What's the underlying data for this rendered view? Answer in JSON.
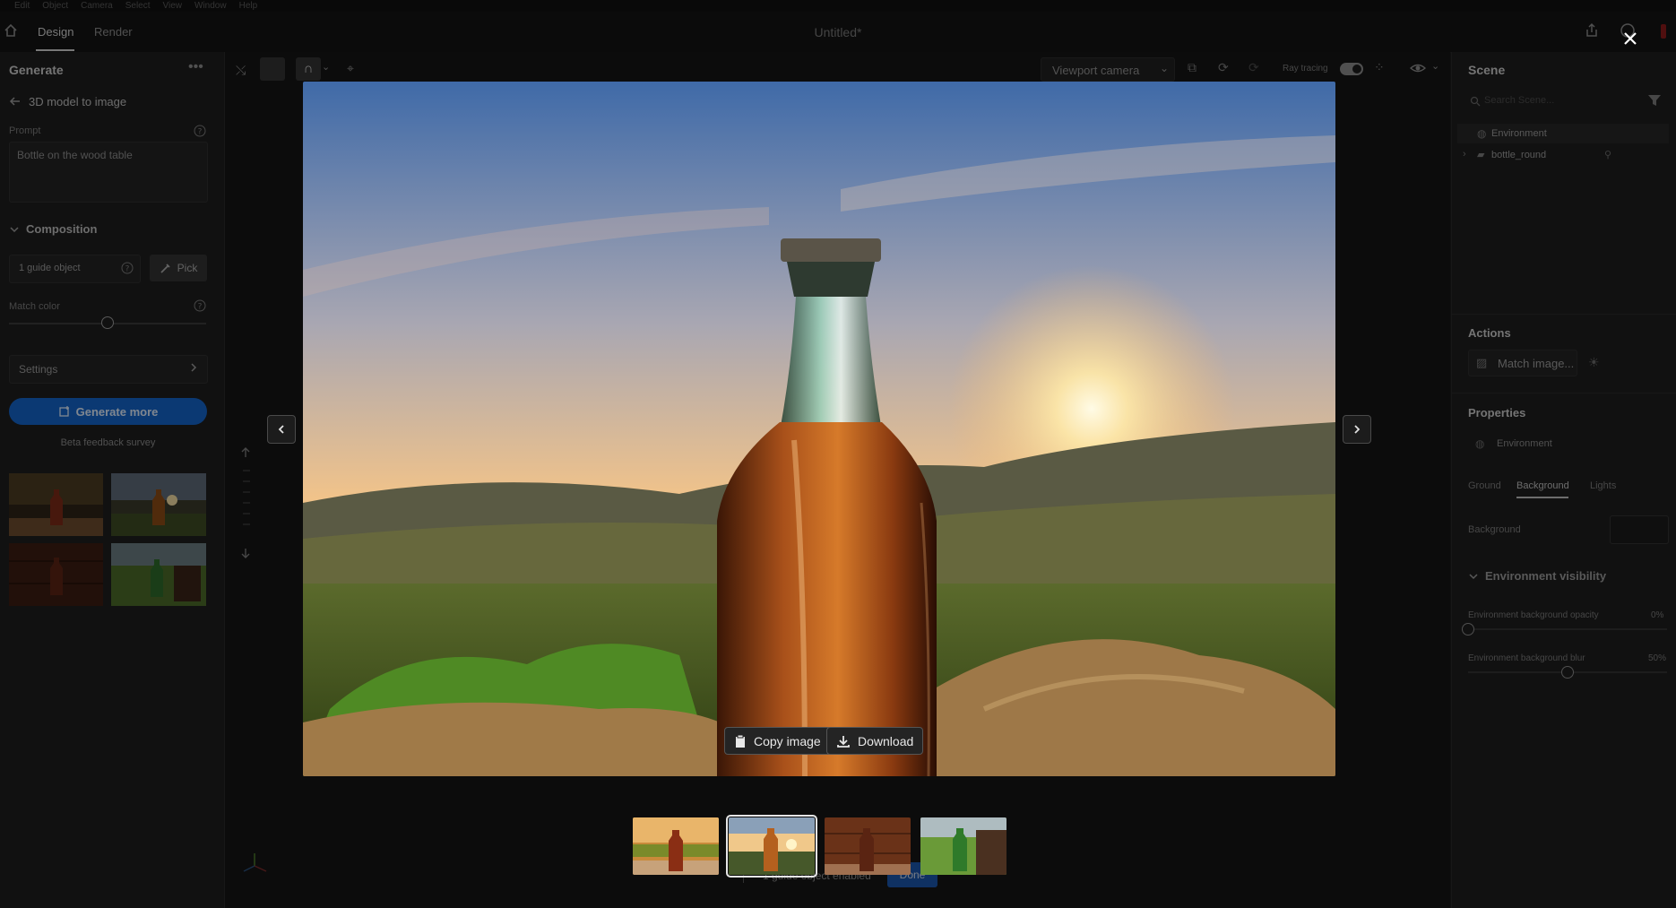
{
  "menu": [
    "Edit",
    "Object",
    "Camera",
    "Select",
    "View",
    "Window",
    "Help"
  ],
  "tabs": {
    "design": "Design",
    "render": "Render"
  },
  "document_title": "Untitled*",
  "left_panel": {
    "title": "Generate",
    "back_label": "3D model to image",
    "prompt_label": "Prompt",
    "prompt_value": "Bottle on the wood table",
    "composition_label": "Composition",
    "guide_object": "1 guide object",
    "pick_label": "Pick",
    "match_color_label": "Match color",
    "match_color_value": 0.5,
    "settings_label": "Settings",
    "generate_more_label": "Generate more",
    "feedback_label": "Beta feedback survey"
  },
  "toolbar": {
    "viewport_camera": "Viewport camera",
    "ray_tracing": "Ray tracing"
  },
  "right_panel": {
    "scene_title": "Scene",
    "search_placeholder": "Search Scene...",
    "tree": [
      {
        "label": "Environment"
      },
      {
        "label": "bottle_round"
      }
    ],
    "actions_title": "Actions",
    "match_image_label": "Match image...",
    "properties_title": "Properties",
    "property_target": "Environment",
    "prop_tabs": [
      "Ground",
      "Background",
      "Lights"
    ],
    "background_label": "Background",
    "env_visibility_label": "Environment visibility",
    "opacity_label": "Environment background opacity",
    "opacity_value": "0%",
    "blur_label": "Environment background blur",
    "blur_value": "50%"
  },
  "footer": {
    "status": "1 guide object enabled",
    "done_label": "Done"
  },
  "overlay": {
    "copy_label": "Copy image",
    "download_label": "Download",
    "selected_index": 1
  },
  "colors": {
    "accent": "#1473e6",
    "panel": "#1e1e1e",
    "viewport": "#151515"
  },
  "icons": [
    "home-icon",
    "more-icon",
    "back-arrow-icon",
    "help-icon",
    "chevron-down-icon",
    "eyedropper-icon",
    "chevron-right-icon",
    "generate-icon",
    "share-icon",
    "close-icon",
    "search-icon",
    "filter-icon",
    "globe-icon",
    "folder-icon",
    "copy-icon",
    "download-icon",
    "arrow-up-icon",
    "arrow-down-icon",
    "eye-icon"
  ]
}
